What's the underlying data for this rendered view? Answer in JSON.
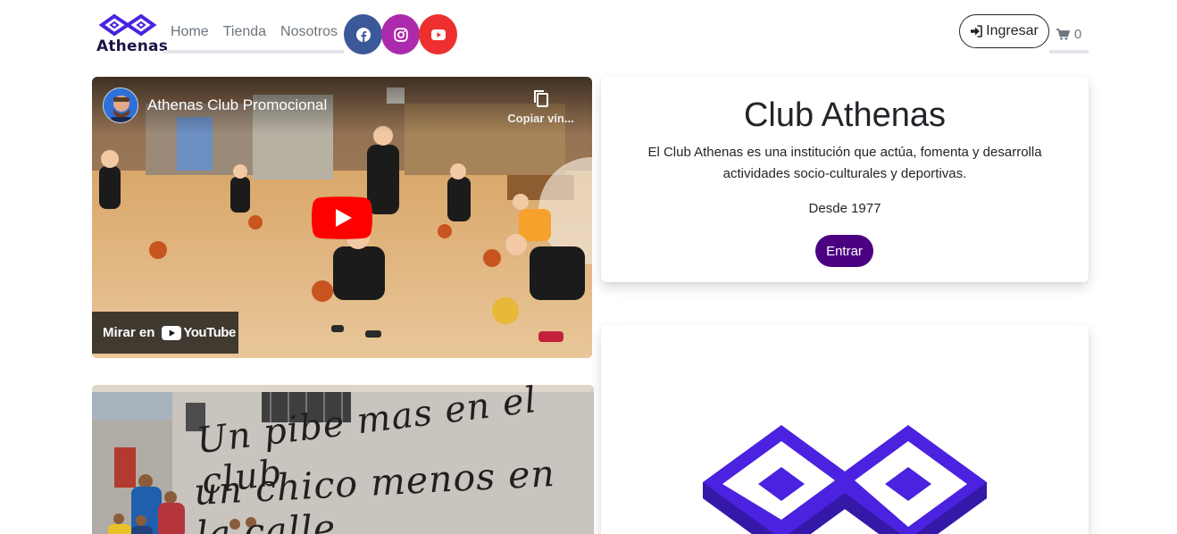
{
  "brand": {
    "name": "Athenas",
    "color": "#4a22e0"
  },
  "nav": {
    "links": [
      {
        "label": "Home"
      },
      {
        "label": "Tienda"
      },
      {
        "label": "Nosotros"
      }
    ],
    "social": [
      {
        "icon": "facebook-icon",
        "color": "#3b5998"
      },
      {
        "icon": "instagram-icon",
        "color": "#ac2bac"
      },
      {
        "icon": "youtube-icon",
        "color": "#ed302f"
      }
    ],
    "login_label": "Ingresar",
    "cart_count": "0"
  },
  "video": {
    "title": "Athenas Club Promocional",
    "copy_label": "Copiar vín...",
    "watch_label": "Mirar en",
    "platform": "YouTube"
  },
  "mural": {
    "line1": "Un pibe mas en el club",
    "line2": "un chico menos en la calle"
  },
  "club_card": {
    "title": "Club Athenas",
    "description": "El Club Athenas es una institución que actúa, fomenta y desarrolla actividades socio-culturales y deportivas.",
    "since": "Desde 1977",
    "button_label": "Entrar",
    "button_color": "#4b0082"
  }
}
